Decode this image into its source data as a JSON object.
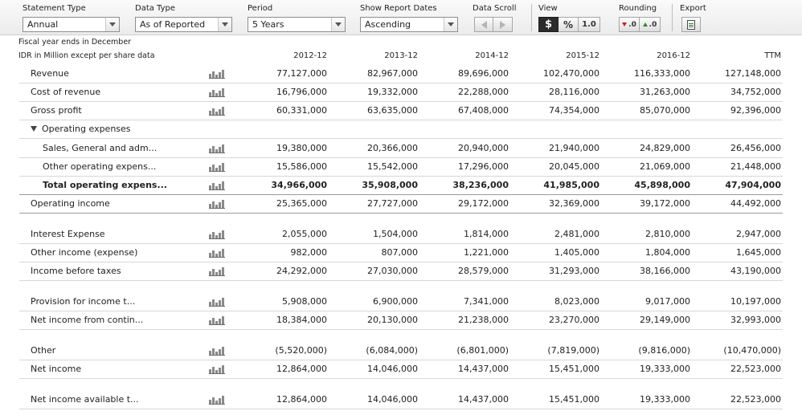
{
  "toolbar": {
    "statement_type": {
      "label": "Statement Type",
      "value": "Annual"
    },
    "data_type": {
      "label": "Data Type",
      "value": "As of Reported"
    },
    "period": {
      "label": "Period",
      "value": "5 Years"
    },
    "report_dates": {
      "label": "Show Report Dates",
      "value": "Ascending"
    },
    "data_scroll": {
      "label": "Data Scroll"
    },
    "view": {
      "label": "View",
      "dollar": "$",
      "percent": "%",
      "one": "1.0"
    },
    "rounding": {
      "label": "Rounding",
      "down": ".0",
      "up": ".0"
    },
    "export": {
      "label": "Export"
    }
  },
  "info": {
    "fiscal_note": "Fiscal year ends in December",
    "units_note": "IDR in Million except per share data"
  },
  "columns": [
    "2012-12",
    "2013-12",
    "2014-12",
    "2015-12",
    "2016-12",
    "TTM"
  ],
  "rows": [
    {
      "label": "Revenue",
      "values": [
        "77,127,000",
        "82,967,000",
        "89,696,000",
        "102,470,000",
        "116,333,000",
        "127,148,000"
      ]
    },
    {
      "label": "Cost of revenue",
      "values": [
        "16,796,000",
        "19,332,000",
        "22,288,000",
        "28,116,000",
        "31,263,000",
        "34,752,000"
      ]
    },
    {
      "label": "Gross profit",
      "values": [
        "60,331,000",
        "63,635,000",
        "67,408,000",
        "74,354,000",
        "85,070,000",
        "92,396,000"
      ]
    },
    {
      "label": "Operating expenses",
      "values": []
    },
    {
      "label": "Sales, General and adm...",
      "values": [
        "19,380,000",
        "20,366,000",
        "20,940,000",
        "21,940,000",
        "24,829,000",
        "26,456,000"
      ]
    },
    {
      "label": "Other operating expens...",
      "values": [
        "15,586,000",
        "15,542,000",
        "17,296,000",
        "20,045,000",
        "21,069,000",
        "21,448,000"
      ]
    },
    {
      "label": "Total operating expens...",
      "values": [
        "34,966,000",
        "35,908,000",
        "38,236,000",
        "41,985,000",
        "45,898,000",
        "47,904,000"
      ]
    },
    {
      "label": "Operating income",
      "values": [
        "25,365,000",
        "27,727,000",
        "29,172,000",
        "32,369,000",
        "39,172,000",
        "44,492,000"
      ]
    },
    {
      "label": "Interest Expense",
      "values": [
        "2,055,000",
        "1,504,000",
        "1,814,000",
        "2,481,000",
        "2,810,000",
        "2,947,000"
      ]
    },
    {
      "label": "Other income (expense)",
      "values": [
        "982,000",
        "807,000",
        "1,221,000",
        "1,405,000",
        "1,804,000",
        "1,645,000"
      ]
    },
    {
      "label": "Income before taxes",
      "values": [
        "24,292,000",
        "27,030,000",
        "28,579,000",
        "31,293,000",
        "38,166,000",
        "43,190,000"
      ]
    },
    {
      "label": "Provision for income t...",
      "values": [
        "5,908,000",
        "6,900,000",
        "7,341,000",
        "8,023,000",
        "9,017,000",
        "10,197,000"
      ]
    },
    {
      "label": "Net income from contin...",
      "values": [
        "18,384,000",
        "20,130,000",
        "21,238,000",
        "23,270,000",
        "29,149,000",
        "32,993,000"
      ]
    },
    {
      "label": "Other",
      "values": [
        "(5,520,000)",
        "(6,084,000)",
        "(6,801,000)",
        "(7,819,000)",
        "(9,816,000)",
        "(10,470,000)"
      ]
    },
    {
      "label": "Net income",
      "values": [
        "12,864,000",
        "14,046,000",
        "14,437,000",
        "15,451,000",
        "19,333,000",
        "22,523,000"
      ]
    },
    {
      "label": "Net income available t...",
      "values": [
        "12,864,000",
        "14,046,000",
        "14,437,000",
        "15,451,000",
        "19,333,000",
        "22,523,000"
      ]
    }
  ]
}
